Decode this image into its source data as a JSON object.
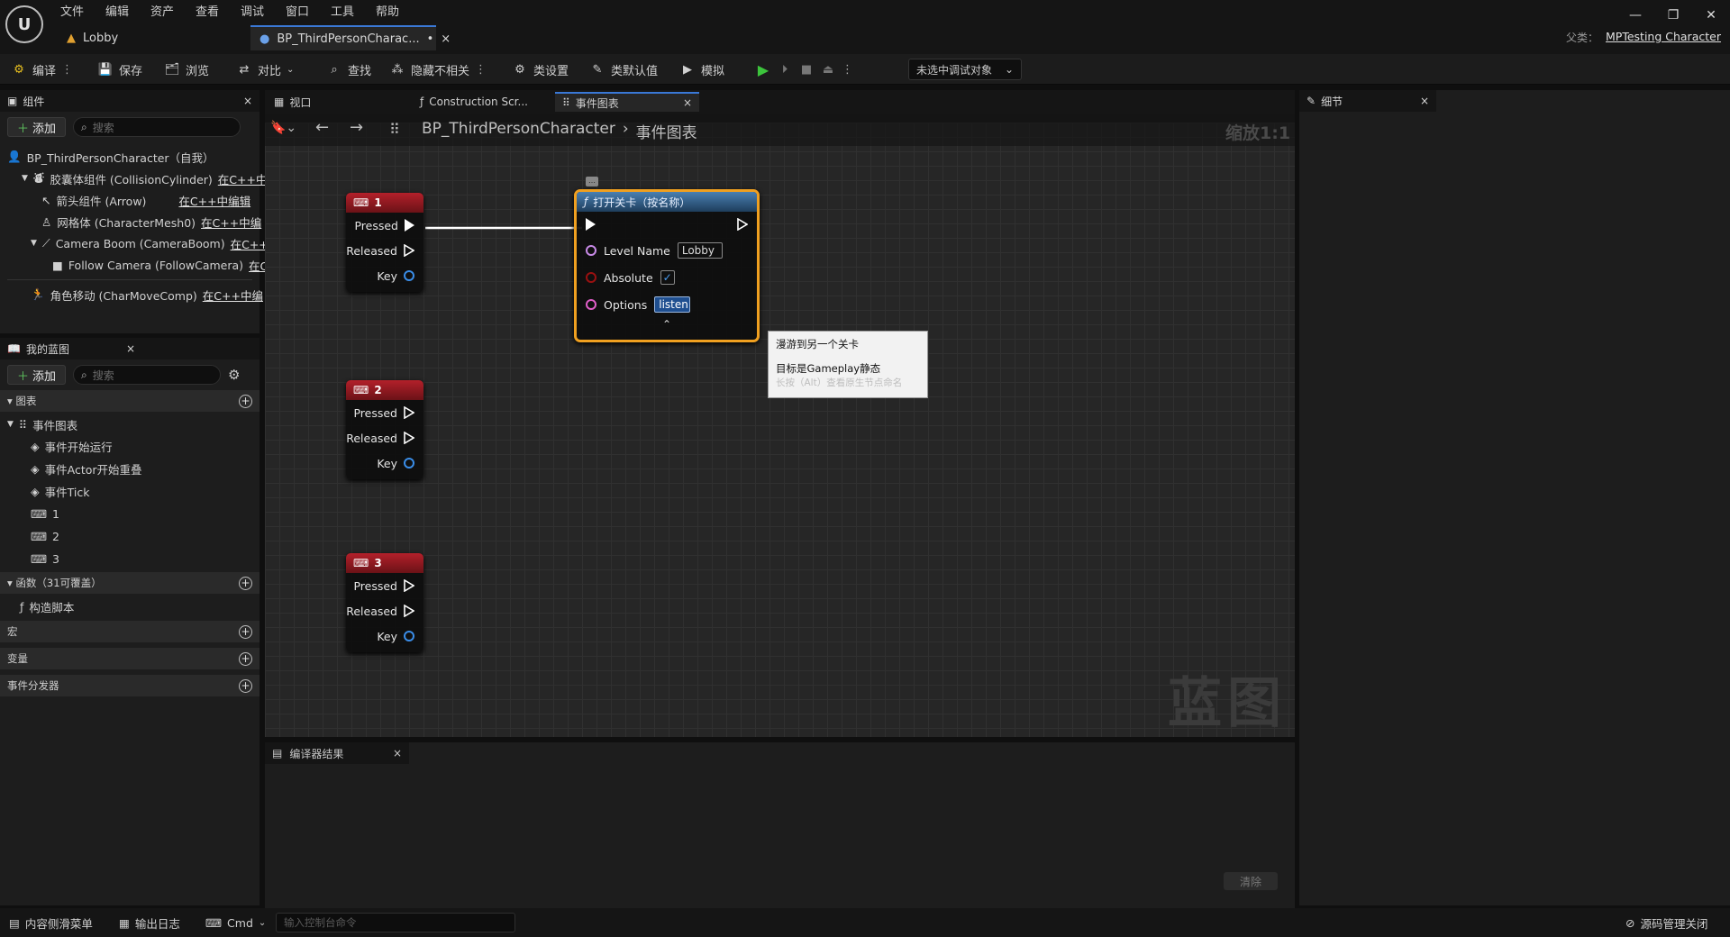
{
  "menu": [
    "文件",
    "编辑",
    "资产",
    "查看",
    "调试",
    "窗口",
    "工具",
    "帮助"
  ],
  "tabs": {
    "lobby": "Lobby",
    "bp": "BP_ThirdPersonCharac...",
    "bp_dirty": "•"
  },
  "parent": {
    "label": "父类：",
    "value": "MPTesting Character"
  },
  "toolbar": {
    "compile": "编译",
    "save": "保存",
    "browse": "浏览",
    "diff": "对比",
    "find": "查找",
    "hide": "隐藏不相关",
    "class_settings": "类设置",
    "class_defaults": "类默认值",
    "simulate": "模拟",
    "debug_object": "未选中调试对象"
  },
  "components": {
    "title": "组件",
    "add": "添加",
    "search": "搜索",
    "root": "BP_ThirdPersonCharacter（自我）",
    "items": [
      {
        "name": "胶囊体组件 (CollisionCylinder)",
        "link": "在C++中"
      },
      {
        "name": "箭头组件 (Arrow)",
        "link": "在C++中编辑"
      },
      {
        "name": "网格体 (CharacterMesh0)",
        "link": "在C++中编"
      },
      {
        "name": "Camera Boom (CameraBoom)",
        "link": "在C++"
      },
      {
        "name": "Follow Camera (FollowCamera)",
        "link": "在C"
      },
      {
        "name": "角色移动 (CharMoveComp)",
        "link": "在C++中编"
      }
    ]
  },
  "myblueprint": {
    "title": "我的蓝图",
    "add": "添加",
    "search": "搜索",
    "graphs_label": "图表",
    "event_graph": "事件图表",
    "events": [
      "事件开始运行",
      "事件Actor开始重叠",
      "事件Tick",
      "1",
      "2",
      "3"
    ],
    "functions_label": "函数（31可覆盖）",
    "construct": "构造脚本",
    "macros": "宏",
    "variables": "变量",
    "dispatchers": "事件分发器"
  },
  "graph_tabs": {
    "viewport": "视口",
    "construction": "Construction Scr...",
    "event_graph": "事件图表"
  },
  "breadcrumb": {
    "bp": "BP_ThirdPersonCharacter",
    "graph": "事件图表",
    "zoom": "缩放1:1"
  },
  "watermark": "蓝图",
  "key_nodes": [
    {
      "title": "1",
      "pressed": "Pressed",
      "released": "Released",
      "key": "Key"
    },
    {
      "title": "2",
      "pressed": "Pressed",
      "released": "Released",
      "key": "Key"
    },
    {
      "title": "3",
      "pressed": "Pressed",
      "released": "Released",
      "key": "Key"
    }
  ],
  "open_level_node": {
    "title": "打开关卡（按名称）",
    "level_name_label": "Level Name",
    "level_name_value": "Lobby",
    "absolute_label": "Absolute",
    "absolute_checked": "✓",
    "options_label": "Options",
    "options_value": "listen"
  },
  "tooltip": {
    "line1": "漫游到另一个关卡",
    "line2": "目标是Gameplay静态",
    "line3": "长按（Alt）查看原生节点命名"
  },
  "details": {
    "title": "细节"
  },
  "compiler": {
    "title": "编译器结果",
    "clear": "清除"
  },
  "statusbar": {
    "drawer": "内容侧滑菜单",
    "log": "输出日志",
    "cmd": "Cmd",
    "cmd_placeholder": "输入控制台命令",
    "source": "源码管理关闭"
  },
  "colors": {
    "accent": "#3a78d6",
    "exec_wire": "#ffffff",
    "key_node_red": "#b3202a",
    "function_blue": "#4a7fb2",
    "selection_orange": "#f0a020"
  }
}
